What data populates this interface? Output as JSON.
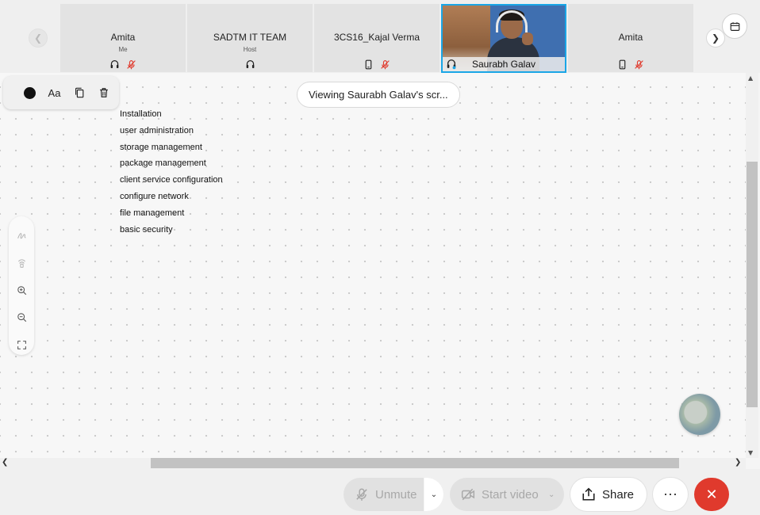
{
  "participants": [
    {
      "name": "Amita",
      "role": "Me",
      "icons": [
        "headset-icon",
        "mic-muted-icon"
      ]
    },
    {
      "name": "SADTM IT TEAM",
      "role": "Host",
      "icons": [
        "headset-icon"
      ]
    },
    {
      "name": "3CS16_Kajal Verma",
      "role": "",
      "icons": [
        "phone-icon",
        "mic-muted-icon"
      ]
    },
    {
      "name": "Saurabh Galav",
      "role": "",
      "icons": [
        "headset-icon"
      ],
      "video": true,
      "highlight_color": "#1aa6e6"
    },
    {
      "name": "Amita",
      "role": "",
      "icons": [
        "phone-icon",
        "mic-muted-icon"
      ]
    }
  ],
  "strip_nav": {
    "prev_icon": "chevron-left-icon",
    "next_icon": "chevron-right-icon",
    "calendar_icon": "calendar-icon"
  },
  "toolbar": {
    "color_value": "#111111",
    "text_label": "Aa",
    "copy_icon": "copy-icon",
    "delete_icon": "trash-icon"
  },
  "viewing_banner": "Viewing Saurabh Galav's scr...",
  "notes": [
    "Installation",
    "user administration",
    "storage management",
    "package management",
    "client service configuration",
    "configure network",
    "file management",
    "basic security"
  ],
  "side_tools": [
    "pen-icon",
    "highlighter-icon",
    "zoom-in-icon",
    "zoom-out-icon",
    "fit-screen-icon"
  ],
  "controls": {
    "unmute_label": "Unmute",
    "video_label": "Start video",
    "share_label": "Share",
    "more_label": "⋯",
    "leave_label": "✕",
    "leave_color": "#e03a2d"
  }
}
